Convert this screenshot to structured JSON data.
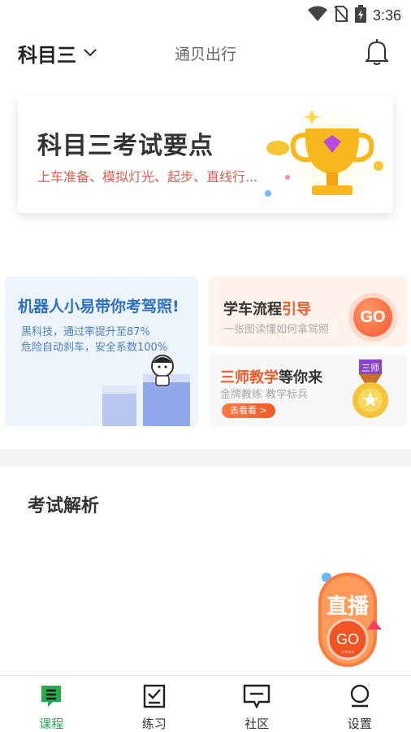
{
  "status_bar": {
    "time": "3:36",
    "icons": [
      "wifi-icon",
      "no-sim-icon",
      "battery-charging-icon"
    ]
  },
  "header": {
    "subject": "科目三",
    "app_title": "通贝出行",
    "icons": [
      "chevron-down-icon",
      "bell-icon"
    ]
  },
  "banner": {
    "title": "科目三考试要点",
    "subtitle": "上车准备、模拟灯光、起步、直线行..."
  },
  "cards": {
    "robot": {
      "title": "机器人小易带你考驾照!",
      "line1": "黑科技，通过率提升至87%",
      "line2": "危险自动刹车，安全系数100%"
    },
    "process": {
      "title_main": "学车流程",
      "title_highlight": "引导",
      "subtitle": "一张图读懂如何拿驾照",
      "go_label": "GO"
    },
    "teachers": {
      "title_highlight": "三师教学",
      "title_main": "等你来",
      "subtitle": "金牌教练 教学标兵",
      "button_label": "去看看 >",
      "medal_text": "三师"
    }
  },
  "section": {
    "title": "考试解析"
  },
  "live": {
    "title": "直播",
    "go_label": "GO",
    "arrows": ">>>>"
  },
  "tabs": [
    {
      "label": "课程",
      "icon": "course-icon",
      "active": true
    },
    {
      "label": "练习",
      "icon": "practice-checklist-icon",
      "active": false
    },
    {
      "label": "社区",
      "icon": "community-chat-icon",
      "active": false
    },
    {
      "label": "设置",
      "icon": "settings-person-icon",
      "active": false
    }
  ],
  "colors": {
    "accent_green": "#20b04b",
    "orange": "#f05a28",
    "blue": "#2d6fc0",
    "red_text": "#e05a4e"
  }
}
